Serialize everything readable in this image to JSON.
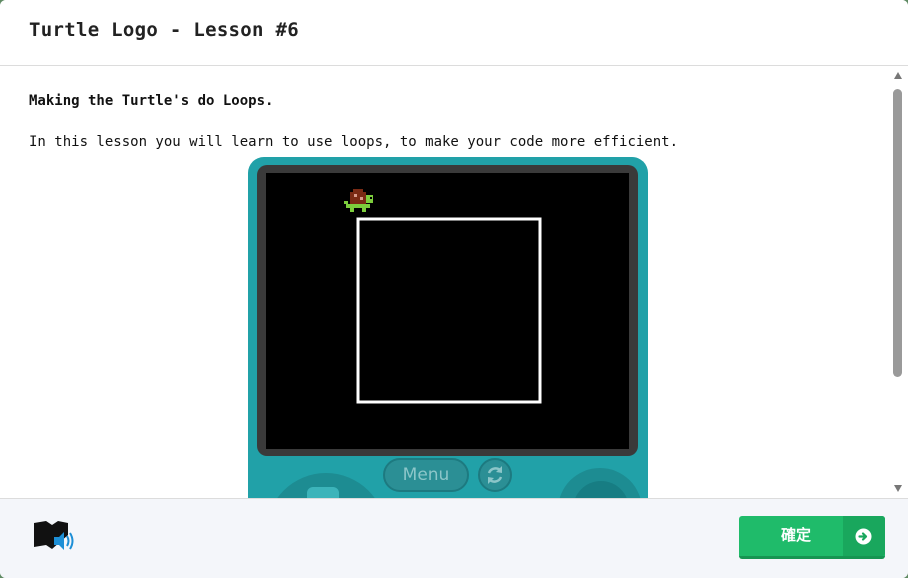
{
  "dialog": {
    "title": "Turtle Logo - Lesson #6"
  },
  "lesson": {
    "subtitle": "Making the Turtle's do Loops.",
    "intro": "In this lesson you will learn to use loops, to make your code more efficient."
  },
  "device": {
    "menu_label": "Menu",
    "refresh_icon": "refresh-icon"
  },
  "footer": {
    "read_aloud_icon": "immersive-reader-icon",
    "confirm_label": "確定",
    "confirm_icon": "arrow-right-circle-icon"
  },
  "colors": {
    "device": "#21a1a8",
    "confirm": "#1fbb6a",
    "turtle_shell": "#7a2a14",
    "turtle_body": "#7ccd3c"
  }
}
